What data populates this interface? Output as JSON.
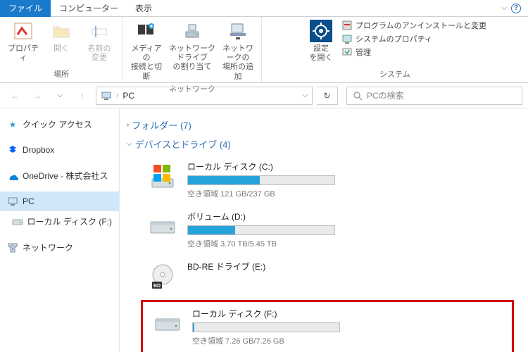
{
  "tabs": {
    "file": "ファイル",
    "computer": "コンピューター",
    "view": "表示"
  },
  "ribbon": {
    "group_location": "場所",
    "group_network": "ネットワーク",
    "group_system": "システム",
    "properties": "プロパティ",
    "open": "開く",
    "rename": "名前の\n変更",
    "media": "メディアの\n接続と切断",
    "map_drive": "ネットワーク ドライブ\nの割り当て",
    "add_location": "ネットワークの\n場所の追加",
    "open_settings": "設定\nを開く",
    "sys_uninstall": "プログラムのアンインストールと変更",
    "sys_props": "システムのプロパティ",
    "sys_manage": "管理"
  },
  "nav": {
    "path": "PC",
    "search_placeholder": "PCの検索"
  },
  "sidebar": {
    "quick": "クイック アクセス",
    "dropbox": "Dropbox",
    "onedrive": "OneDrive - 株式会社ス",
    "pc": "PC",
    "local_f": "ローカル ディスク (F:)",
    "network": "ネットワーク"
  },
  "content": {
    "folders_header": "フォルダー (7)",
    "devices_header": "デバイスとドライブ (4)",
    "drives": [
      {
        "name": "ローカル ディスク (C:)",
        "sub": "空き領域 121 GB/237 GB",
        "fill": 49,
        "color": "#27a3db",
        "icon": "c"
      },
      {
        "name": "ボリューム (D:)",
        "sub": "空き領域 3.70 TB/5.45 TB",
        "fill": 32,
        "color": "#27a3db",
        "icon": "hdd"
      },
      {
        "name": "BD-RE ドライブ (E:)",
        "sub": "",
        "fill": null,
        "icon": "bd"
      },
      {
        "name": "ローカル ディスク (F:)",
        "sub": "空き領域 7.26 GB/7.26 GB",
        "fill": 1,
        "color": "#27a3db",
        "icon": "hdd",
        "highlight": true
      }
    ]
  }
}
